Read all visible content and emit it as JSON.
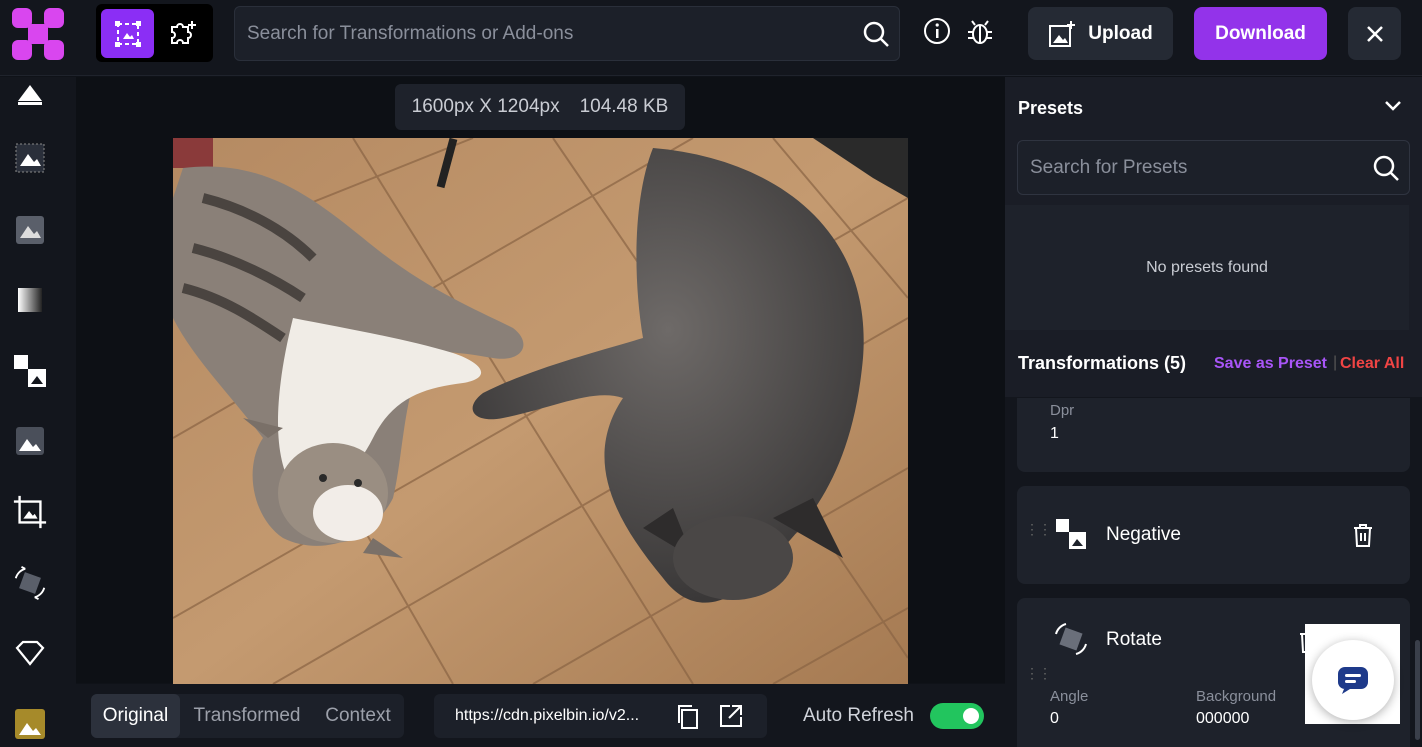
{
  "header": {
    "search_placeholder": "Search for Transformations or Add-ons",
    "upload_label": "Upload",
    "download_label": "Download"
  },
  "canvas": {
    "dimensions": "1600px X 1204px",
    "filesize": "104.48 KB"
  },
  "view_tabs": [
    "Original",
    "Transformed",
    "Context"
  ],
  "url": "https://cdn.pixelbin.io/v2...",
  "auto_refresh_label": "Auto Refresh",
  "auto_refresh_on": true,
  "presets": {
    "title": "Presets",
    "search_placeholder": "Search for Presets",
    "empty_text": "No presets found"
  },
  "transformations": {
    "title": "Transformations (5)",
    "save_preset": "Save as Preset",
    "clear_all": "Clear All",
    "separator": "|",
    "items": [
      {
        "param_label": "Dpr",
        "param_value": "1"
      },
      {
        "name": "Negative"
      },
      {
        "name": "Rotate",
        "params": [
          {
            "label": "Angle",
            "value": "0"
          },
          {
            "label": "Background",
            "value": "000000"
          }
        ]
      }
    ]
  },
  "colors": {
    "accent": "#9333ea",
    "danger": "#ef4444",
    "toggle_on": "#22c55e"
  }
}
